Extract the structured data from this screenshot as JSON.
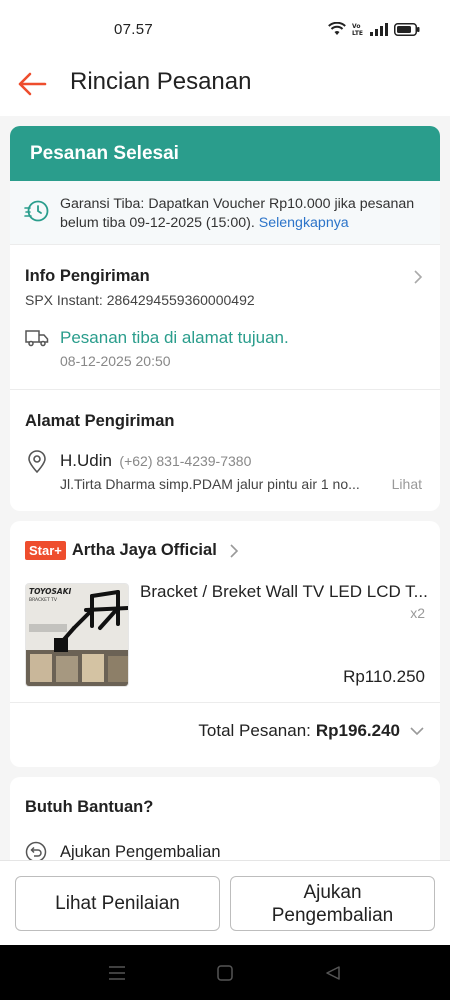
{
  "status_bar": {
    "time": "07.57"
  },
  "header": {
    "title": "Rincian Pesanan"
  },
  "order_status": {
    "banner": "Pesanan Selesai",
    "guarantee_text": "Garansi Tiba: Dapatkan Voucher Rp10.000 jika pesanan belum tiba 09-12-2025 (15:00).",
    "guarantee_link": "Selengkapnya"
  },
  "shipping": {
    "title": "Info Pengiriman",
    "courier": "SPX Instant: 2864294559360000492",
    "status": "Pesanan tiba di alamat tujuan.",
    "status_time": "08-12-2025 20:50"
  },
  "address": {
    "title": "Alamat Pengiriman",
    "name": "H.Udin",
    "phone": "(+62) 831-4239-7380",
    "detail": "Jl.Tirta Dharma simp.PDAM jalur pintu air 1 no...",
    "see_more": "Lihat"
  },
  "shop": {
    "badge": "Star+",
    "name": "Artha Jaya Official",
    "product": {
      "name": "Bracket / Breket Wall TV LED LCD T...",
      "quantity": "x2",
      "price": "Rp110.250",
      "thumb_brand": "TOYOSAKI",
      "thumb_sub": "BRACKET TV"
    },
    "total_label": "Total Pesanan:",
    "total_value": "Rp196.240"
  },
  "help": {
    "title": "Butuh Bantuan?",
    "return_label": "Ajukan Pengembalian"
  },
  "actions": {
    "review_button": "Lihat Penilaian",
    "return_button": "Ajukan Pengembalian"
  },
  "colors": {
    "accent_teal": "#2a9d8c",
    "brand_orange": "#ee4d2d",
    "link_blue": "#2c74c9"
  }
}
